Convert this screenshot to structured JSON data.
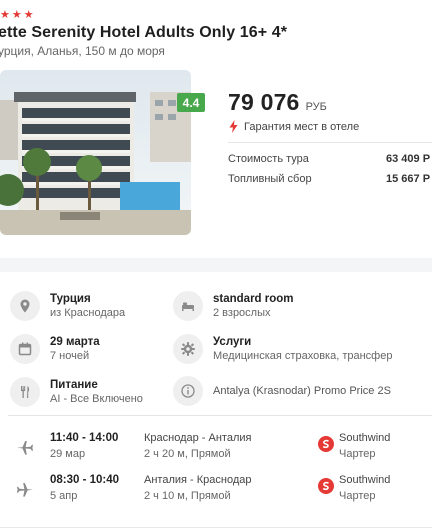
{
  "hotel": {
    "stars": 3,
    "name": "ette Serenity Hotel Adults Only 16+ 4*",
    "location": "урция, Аланья, 150 м до моря",
    "rating": "4.4",
    "photo_icon": "hotel-photo"
  },
  "price": {
    "total": "79 076",
    "currency": "РУБ",
    "guarantee": "Гарантия мест в отеле",
    "tour_cost_label": "Стоимость тура",
    "tour_cost_value": "63 409 Р",
    "fuel_label": "Топливный сбор",
    "fuel_value": "15 667 Р"
  },
  "details": {
    "country": {
      "title": "Турция",
      "sub": "из Краснодара",
      "icon": "location-pin-icon"
    },
    "room": {
      "title": "standard room",
      "sub": "2 взрослых",
      "icon": "bed-icon"
    },
    "dates": {
      "title": "29 марта",
      "sub": "7 ночей",
      "icon": "calendar-icon"
    },
    "services": {
      "title": "Услуги",
      "sub": "Медицинская страховка, трансфер",
      "icon": "gear-icon"
    },
    "meals": {
      "title": "Питание",
      "sub": "AI - Все Включено",
      "icon": "cutlery-icon"
    },
    "promo": {
      "text": "Antalya (Krasnodar) Promo Price 2S",
      "icon": "info-icon"
    }
  },
  "flights": [
    {
      "time": "11:40 - 14:00",
      "date": "29 мар",
      "route": "Краснодар - Анталия",
      "duration": "2 ч 20 м, Прямой",
      "airline": "Southwind",
      "type": "Чартер",
      "direction": "outbound"
    },
    {
      "time": "08:30 - 10:40",
      "date": "5 апр",
      "route": "Анталия - Краснодар",
      "duration": "2 ч 10 м, Прямой",
      "airline": "Southwind",
      "type": "Чартер",
      "direction": "return"
    }
  ],
  "colors": {
    "accent": "#e53935",
    "rating_bg": "#47a84c"
  }
}
